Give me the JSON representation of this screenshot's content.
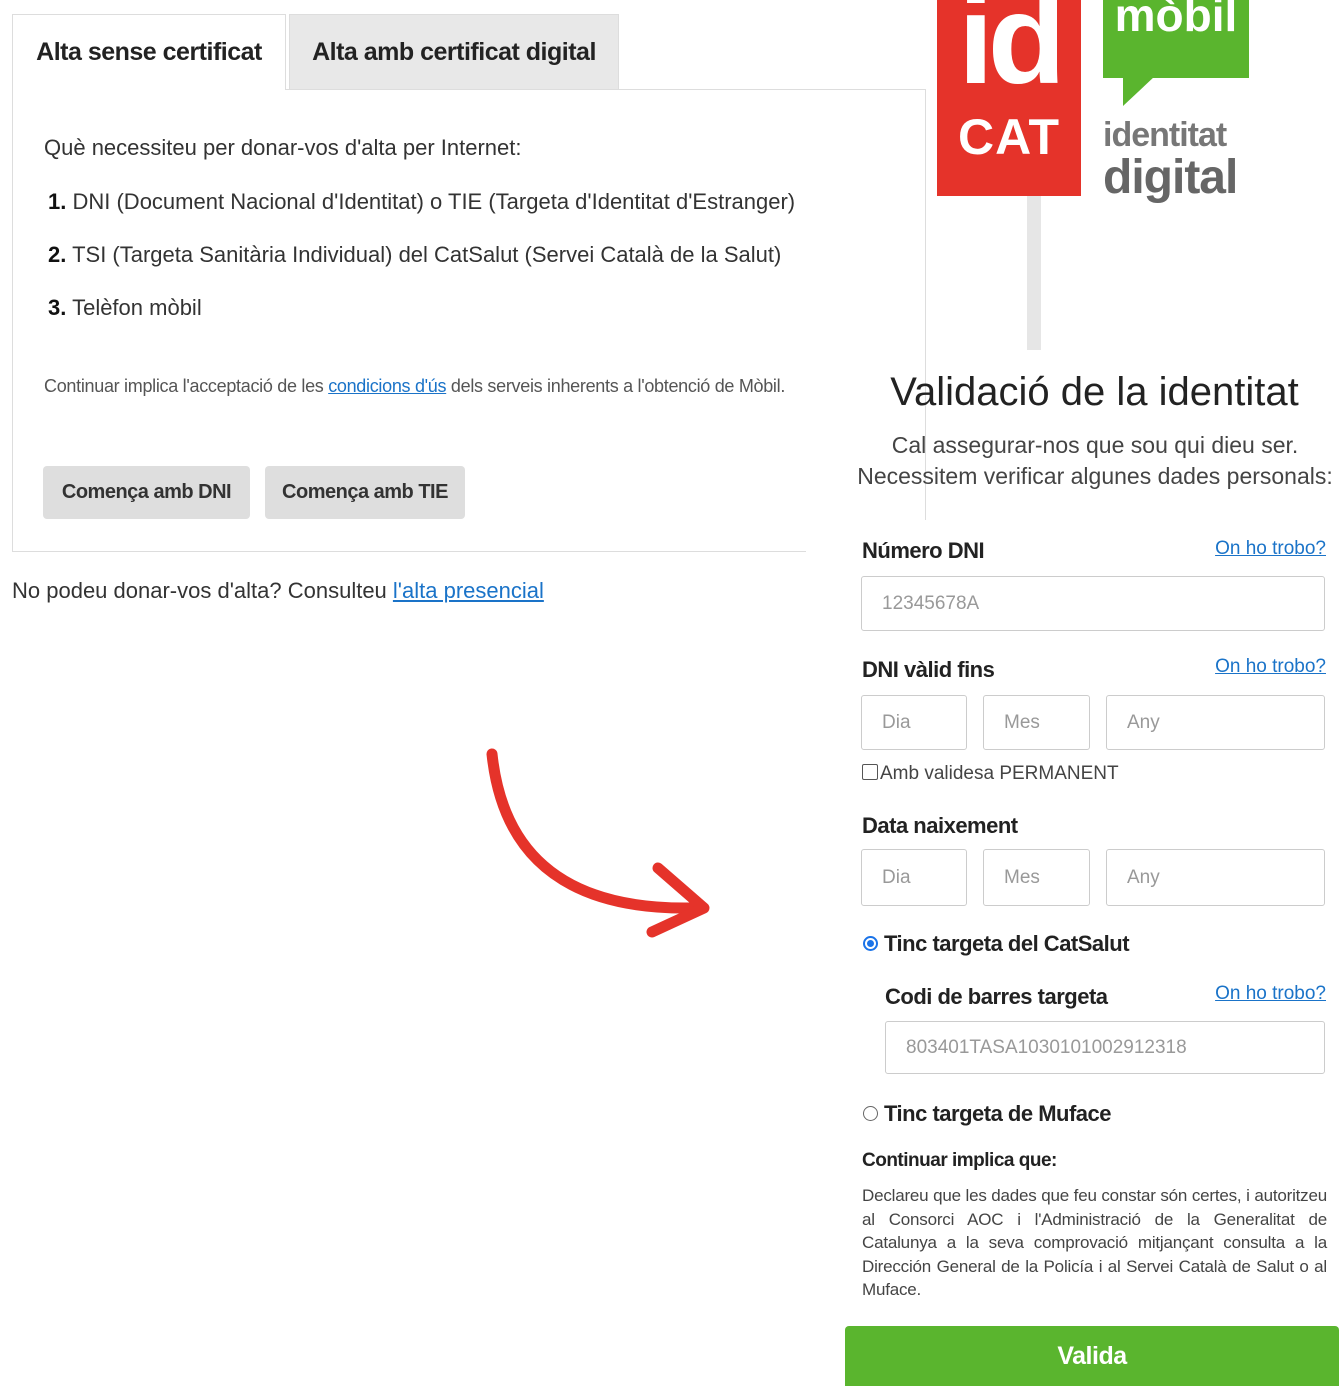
{
  "tabs": {
    "active": "Alta sense certificat",
    "inactive": "Alta amb certificat digital"
  },
  "left": {
    "intro": "Què necessiteu per donar-vos d'alta per Internet:",
    "requirements": [
      {
        "num": "1.",
        "text": "DNI (Document Nacional d'Identitat) o TIE (Targeta d'Identitat d'Estranger)"
      },
      {
        "num": "2.",
        "text": "TSI (Targeta Sanitària Individual) del CatSalut (Servei Català de la Salut)"
      },
      {
        "num": "3.",
        "text": "Telèfon mòbil"
      }
    ],
    "terms_before": "Continuar implica l'acceptació de les ",
    "terms_link": "condicions d'ús",
    "terms_after": " dels serveis inherents a l'obtenció de Mòbil.",
    "btn_dni": "Comença amb DNI",
    "btn_tie": "Comença amb TIE",
    "note_text": "No podeu donar-vos d'alta? Consulteu ",
    "note_link": "l'alta presencial"
  },
  "logo": {
    "id": "id",
    "cat": "CAT",
    "mobil": "mòbil",
    "identitat": "identitat",
    "digital": "digital"
  },
  "form": {
    "title": "Validació de la identitat",
    "subtitle1": "Cal assegurar-nos que sou qui dieu ser.",
    "subtitle2": "Necessitem verificar algunes dades personals:",
    "help_link": "On ho trobo?",
    "dni_label": "Número DNI",
    "dni_placeholder": "12345678A",
    "valid_label": "DNI vàlid fins",
    "day_placeholder": "Dia",
    "month_placeholder": "Mes",
    "year_placeholder": "Any",
    "permanent_label": "Amb validesa PERMANENT",
    "birth_label": "Data naixement",
    "radio_catsalut": "Tinc targeta del CatSalut",
    "barcode_label": "Codi de barres targeta",
    "barcode_placeholder": "803401TASA1030101002912318",
    "radio_muface": "Tinc targeta de Muface",
    "continue_heading": "Continuar implica que:",
    "continue_text": "Declareu que les dades que feu constar són certes, i autoritzeu al Consorci AOC i l'Administració de la Generalitat de Catalunya a la seva comprovació mitjançant consulta a la Dirección General de la Policía i al Servei Català de Salut o al Muface.",
    "submit": "Valida"
  },
  "colors": {
    "logo_red": "#e5332a",
    "logo_green": "#5ab52e",
    "link_blue": "#1a73c8",
    "arrow_red": "#e5332a",
    "submit_green": "#5ab52e"
  }
}
